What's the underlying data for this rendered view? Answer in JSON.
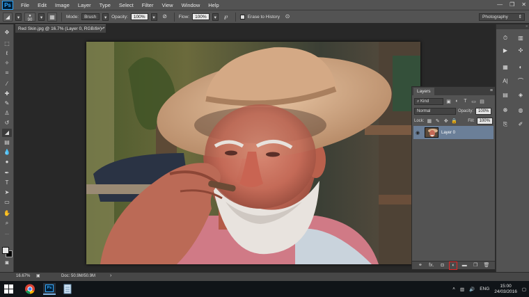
{
  "app": {
    "logo": "Ps",
    "menu": [
      "File",
      "Edit",
      "Image",
      "Layer",
      "Type",
      "Select",
      "Filter",
      "View",
      "Window",
      "Help"
    ]
  },
  "options_bar": {
    "brush_size": "90",
    "mode_label": "Mode:",
    "mode_value": "Brush",
    "opacity_label": "Opacity:",
    "opacity_value": "100%",
    "flow_label": "Flow:",
    "flow_value": "100%",
    "erase_history_label": "Erase to History",
    "workspace": "Photography"
  },
  "document": {
    "tab_title": "Red Skin.jpg @ 16.7% (Layer 0, RGB/8#) *",
    "tab_close": "×"
  },
  "status": {
    "zoom": "16.67%",
    "doc_size": "Doc: 50.9M/50.9M",
    "arrow": "›"
  },
  "layers_panel": {
    "title": "Layers",
    "filter_kind": "Kind",
    "blend_mode": "Normal",
    "opacity_label": "Opacity:",
    "opacity_value": "100%",
    "lock_label": "Lock:",
    "fill_label": "Fill:",
    "fill_value": "100%",
    "layers": [
      {
        "name": "Layer 0",
        "visible": true,
        "selected": true
      }
    ],
    "footer_icons": [
      "link-layers-icon",
      "fx-icon",
      "mask-icon",
      "adjustment-layer-icon",
      "folder-icon",
      "new-layer-icon",
      "trash-icon"
    ],
    "footer_fx": "fx."
  },
  "taskbar": {
    "lang": "ENG",
    "time": "15:00",
    "date": "24/03/2016"
  },
  "colors": {
    "accent_highlight": "#e32626",
    "ps_blue": "#31a8ff",
    "selected_layer": "#6b7f98"
  }
}
